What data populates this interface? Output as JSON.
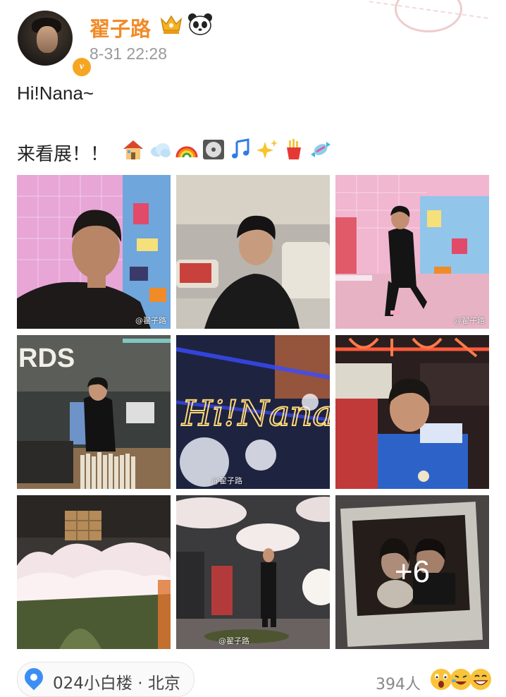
{
  "post": {
    "username": "翟子路",
    "time": "8-31 22:28",
    "verified_mark": "v",
    "text_line1": "Hi!Nana~",
    "text_line2": "来看展！！",
    "emojis": [
      "house-icon",
      "cloud-icon",
      "rainbow-icon",
      "cd-icon",
      "music-note-icon",
      "sparkles-icon",
      "fries-icon",
      "candy-icon"
    ],
    "badges": [
      "crown-badge-icon",
      "panda-badge-icon"
    ]
  },
  "photos": {
    "watermark": "@翟子路",
    "more_count": "+6"
  },
  "footer": {
    "location": "024小白楼 · 北京",
    "people_count": "394人",
    "reaction_icons": [
      "wow-face-icon",
      "laugh-face-icon",
      "grin-face-icon"
    ]
  },
  "colors": {
    "username": "#f08b28",
    "location_icon": "#3c8ef5"
  }
}
